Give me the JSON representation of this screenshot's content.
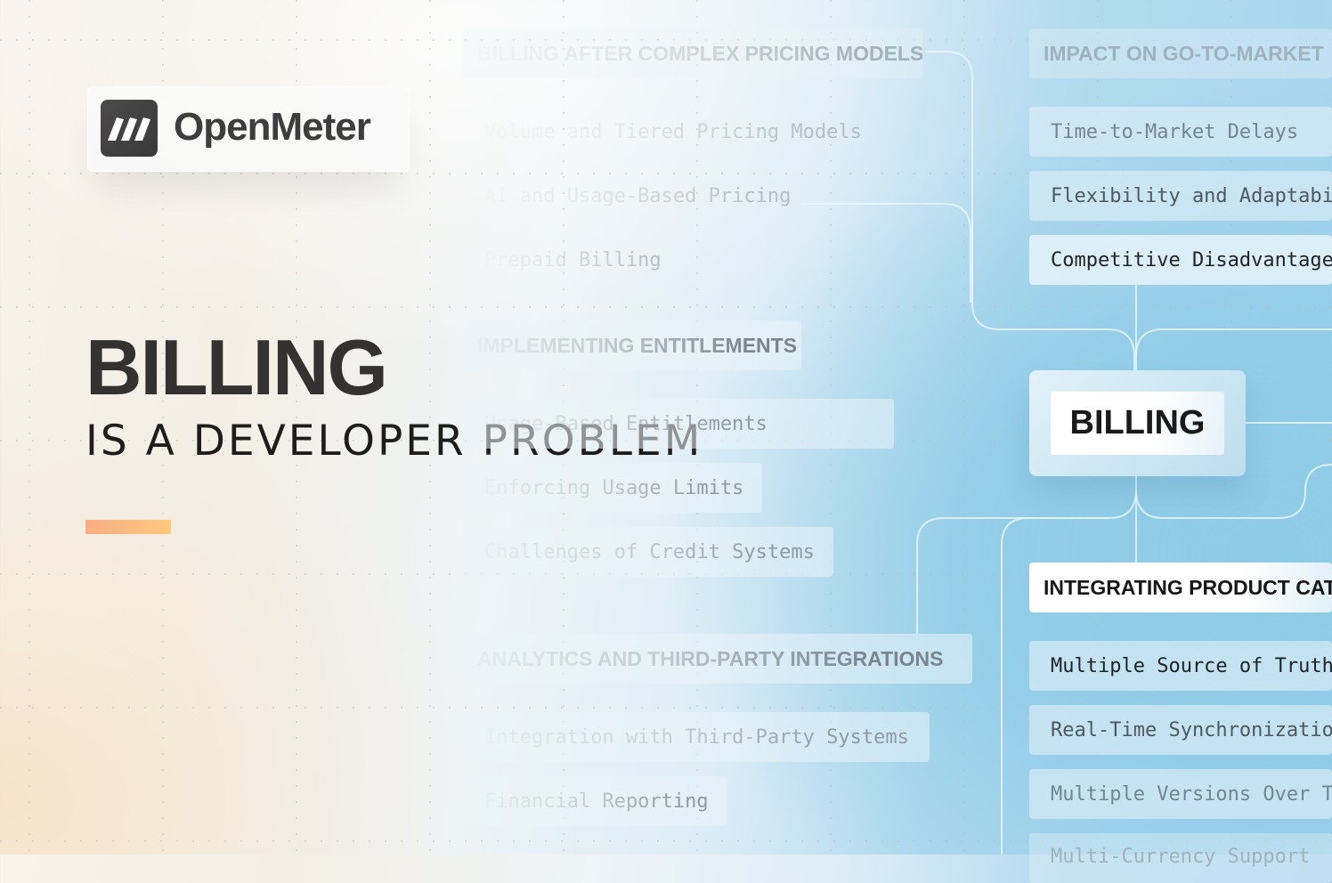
{
  "brand": {
    "name": "OpenMeter",
    "logo_icon": "three-slanted-bars-icon"
  },
  "hero": {
    "title": "BILLING",
    "subtitle": "IS A DEVELOPER PROBLEM",
    "accent_colors": [
      "#f9ae86",
      "#fdc97c"
    ]
  },
  "mindmap": {
    "center": "BILLING",
    "middle_column": [
      {
        "heading": "BILLING AFTER COMPLEX PRICING MODELS",
        "items": [
          "Volume and Tiered Pricing Models",
          "AI and Usage-Based Pricing",
          "Prepaid Billing"
        ]
      },
      {
        "heading": "IMPLEMENTING ENTITLEMENTS",
        "items": [
          "Usage-Based Entitlements",
          "Enforcing Usage Limits",
          "Challenges of Credit Systems"
        ]
      },
      {
        "heading": "ANALYTICS AND THIRD-PARTY INTEGRATIONS",
        "items": [
          "Integration with Third-Party Systems",
          "Financial Reporting"
        ]
      }
    ],
    "right_column": [
      {
        "heading": "IMPACT ON GO-TO-MARKET",
        "items": [
          "Time-to-Market Delays",
          "Flexibility and Adaptability",
          "Competitive Disadvantage"
        ]
      },
      {
        "heading": "INTEGRATING PRODUCT CATALOG",
        "items": [
          "Multiple Source of Truth",
          "Real-Time Synchronization",
          "Multiple Versions Over Time",
          "Multi-Currency Support"
        ]
      }
    ]
  },
  "colors": {
    "background_warm": "#f6e6cf",
    "background_blue": "#9fd2ec",
    "text_dark": "#333230"
  }
}
